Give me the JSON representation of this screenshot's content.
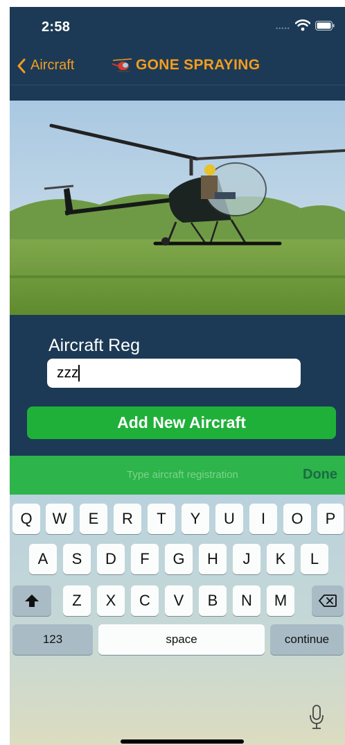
{
  "status_bar": {
    "time": "2:58"
  },
  "nav": {
    "back_label": "Aircraft",
    "title": "GONE SPRAYING"
  },
  "form": {
    "reg_label": "Aircraft Reg",
    "reg_value": "zzz",
    "add_button": "Add New Aircraft"
  },
  "accessory": {
    "placeholder": "Type aircraft registration",
    "done": "Done"
  },
  "keyboard": {
    "row1": [
      "Q",
      "W",
      "E",
      "R",
      "T",
      "Y",
      "U",
      "I",
      "O",
      "P"
    ],
    "row2": [
      "A",
      "S",
      "D",
      "F",
      "G",
      "H",
      "J",
      "K",
      "L"
    ],
    "row3": [
      "Z",
      "X",
      "C",
      "V",
      "B",
      "N",
      "M"
    ],
    "numbers": "123",
    "space": "space",
    "return": "continue"
  },
  "colors": {
    "background": "#1c3a55",
    "accent": "#f39c21",
    "button_green": "#1fb03a",
    "accessory_green": "#2db44a"
  },
  "icons": [
    "back-chevron-icon",
    "helicopter-logo-icon",
    "wifi-icon",
    "battery-icon",
    "shift-icon",
    "backspace-icon",
    "microphone-icon"
  ]
}
